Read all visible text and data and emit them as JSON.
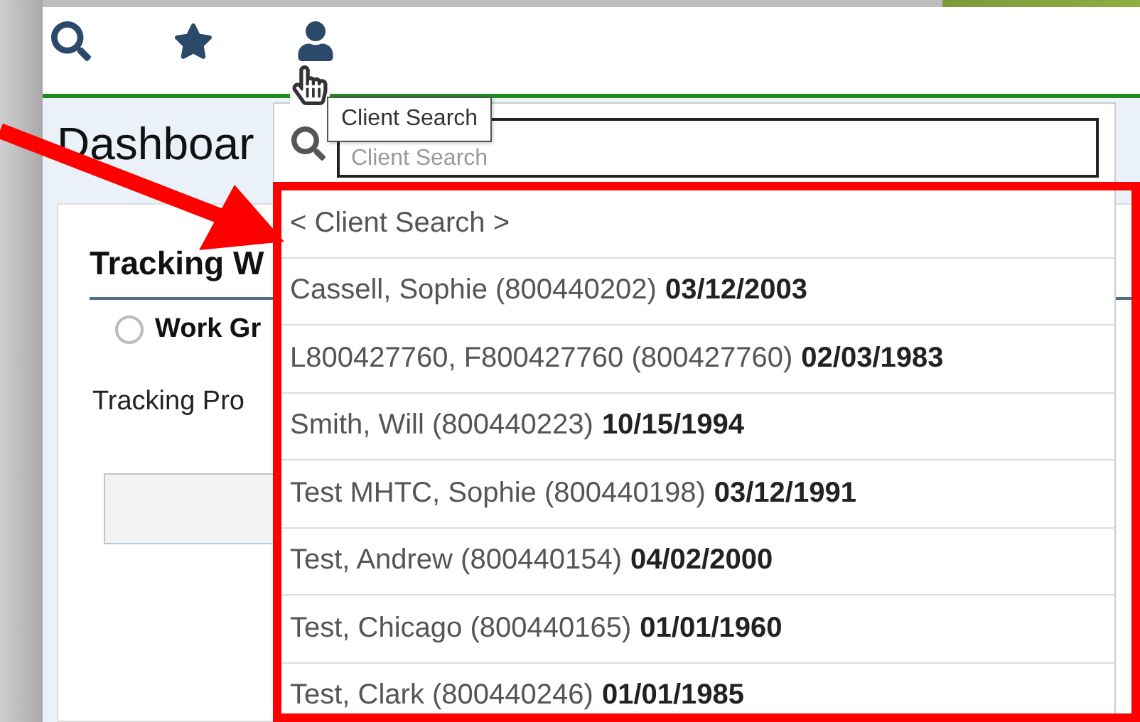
{
  "toolbar": {
    "tooltip": "Client Search"
  },
  "page": {
    "title": "Dashboar",
    "card": {
      "title": "Tracking W",
      "radio": {
        "label": "Work Gr",
        "selected": false
      },
      "field_label": "Tracking Pro"
    }
  },
  "client_search": {
    "placeholder": "Client Search",
    "items": [
      {
        "kind": "header",
        "label": "< Client Search >"
      },
      {
        "kind": "client",
        "name": "Cassell, Sophie (800440202)",
        "dob": "03/12/2003"
      },
      {
        "kind": "client",
        "name": "L800427760, F800427760 (800427760)",
        "dob": "02/03/1983"
      },
      {
        "kind": "client",
        "name": "Smith, Will (800440223)",
        "dob": "10/15/1994"
      },
      {
        "kind": "client",
        "name": "Test MHTC, Sophie (800440198)",
        "dob": "03/12/1991"
      },
      {
        "kind": "client",
        "name": "Test, Andrew (800440154)",
        "dob": "04/02/2000"
      },
      {
        "kind": "client",
        "name": "Test, Chicago (800440165)",
        "dob": "01/01/1960"
      },
      {
        "kind": "client",
        "name": "Test, Clark (800440246)",
        "dob": "01/01/1985"
      }
    ]
  }
}
